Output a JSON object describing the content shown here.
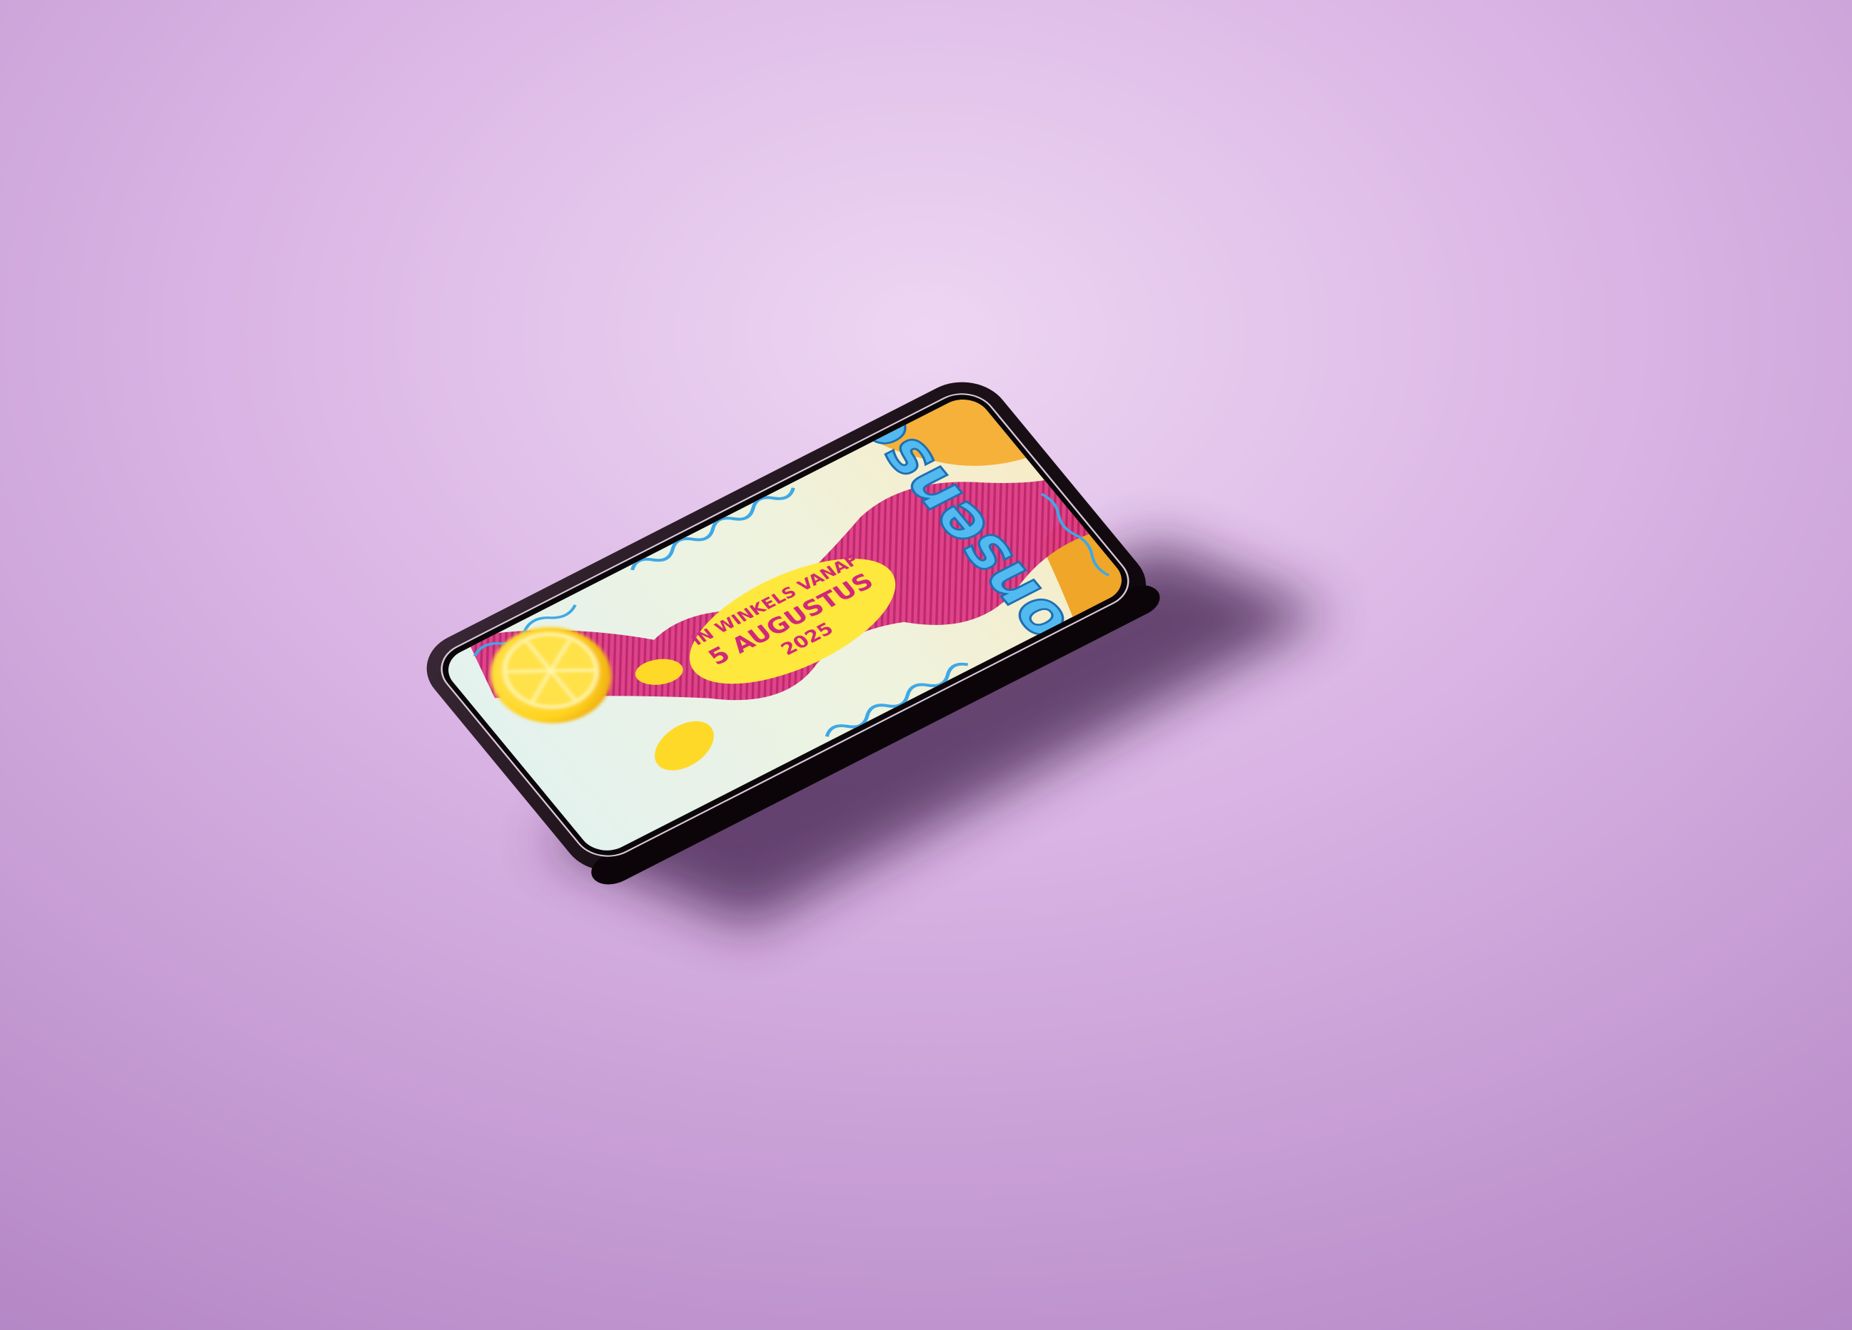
{
  "poster": {
    "brand": "nonsense",
    "line1": "IN WINKELS VANAF",
    "line2": "5 AUGUSTUS",
    "line3": "2025"
  },
  "colors": {
    "background": "#d7b0e2",
    "phone_body": "#1d1219",
    "brand_blue": "#4ab3ea",
    "pink": "#d8337f",
    "yellow": "#ffe63d",
    "orange": "#f5b13a",
    "screen_bg": "#e9f3ee",
    "text_pink": "#d0287a"
  },
  "icons": {
    "lemon": "lemon-half-icon"
  }
}
